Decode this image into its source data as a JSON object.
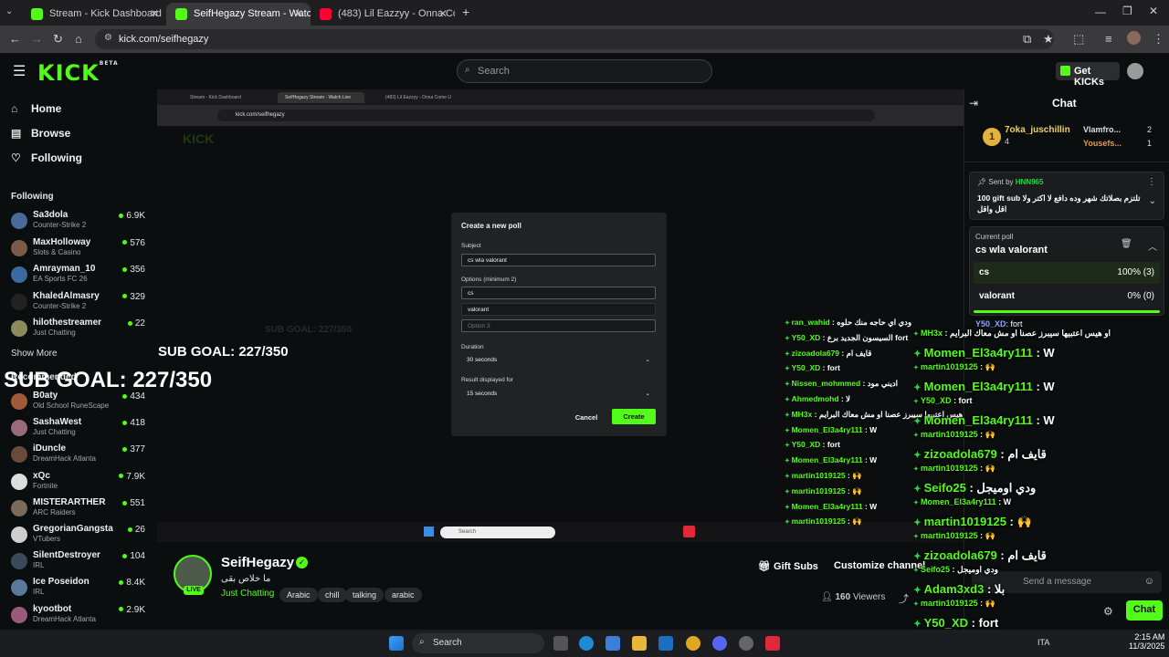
{
  "browser": {
    "tabs": [
      {
        "title": "Stream - Kick Dashboard",
        "favicon_color": "#53fc18"
      },
      {
        "title": "SeifHegazy Stream - Watch Live",
        "favicon_color": "#53fc18"
      },
      {
        "title": "(483) Lil Eazzyy - Onna Come U",
        "favicon_color": "#ff0033"
      }
    ],
    "url": "kick.com/seifhegazy"
  },
  "header": {
    "logo": "KICK",
    "logo_badge": "BETA",
    "search_placeholder": "Search",
    "get_kicks": "Get KICKs"
  },
  "sidebar": {
    "nav": [
      {
        "label": "Home",
        "icon": "home-icon"
      },
      {
        "label": "Browse",
        "icon": "browse-icon"
      },
      {
        "label": "Following",
        "icon": "heart-icon"
      }
    ],
    "following_heading": "Following",
    "following": [
      {
        "name": "Sa3dola",
        "category": "Counter-Strike 2",
        "viewers": "6.9K",
        "avatar_color": "#4a6a9a"
      },
      {
        "name": "MaxHolloway",
        "category": "Slots & Casino",
        "viewers": "576",
        "avatar_color": "#7a5a4a"
      },
      {
        "name": "Amrayman_10",
        "category": "EA Sports FC 26",
        "viewers": "356",
        "avatar_color": "#3a6aa0"
      },
      {
        "name": "KhaledAlmasry",
        "category": "Counter-Strike 2",
        "viewers": "329",
        "avatar_color": "#222222"
      },
      {
        "name": "hilothestreamer",
        "category": "Just Chatting",
        "viewers": "22",
        "avatar_color": "#8a8a5a"
      }
    ],
    "show_more": "Show More",
    "recommended_heading": "Recommended",
    "recommended": [
      {
        "name": "B0aty",
        "category": "Old School RuneScape",
        "viewers": "434",
        "avatar_color": "#a05a3a"
      },
      {
        "name": "SashaWest",
        "category": "Just Chatting",
        "viewers": "418",
        "avatar_color": "#9a6a7a"
      },
      {
        "name": "iDuncle",
        "category": "DreamHack Atlanta",
        "viewers": "377",
        "avatar_color": "#6a4a3a"
      },
      {
        "name": "xQc",
        "category": "Fortnite",
        "viewers": "7.9K",
        "avatar_color": "#dddddd"
      },
      {
        "name": "MISTERARTHER",
        "category": "ARC Raiders",
        "viewers": "551",
        "avatar_color": "#7a6a5a"
      },
      {
        "name": "GregorianGangsta",
        "category": "VTubers",
        "viewers": "26",
        "avatar_color": "#cfcfcf"
      },
      {
        "name": "SilentDestroyer",
        "category": "IRL",
        "viewers": "104",
        "avatar_color": "#3a4a5a"
      },
      {
        "name": "Ice Poseidon",
        "category": "IRL",
        "viewers": "8.4K",
        "avatar_color": "#5a7a9a"
      },
      {
        "name": "kyootbot",
        "category": "DreamHack Atlanta",
        "viewers": "2.9K",
        "avatar_color": "#9a5a7a"
      }
    ]
  },
  "stream_overlay": {
    "sub_goal_small": "SUB GOAL: 227/350",
    "sub_goal_large": "SUB GOAL: 227/350",
    "inner_url": "kick.com/seifhegazy",
    "inner_tabs": [
      "Stream - Kick Dashboard",
      "SeifHegazy Stream - Watch Live",
      "(483) Lil Eazzyy - Onna Come U"
    ],
    "inner_search": "Search",
    "poll_dialog": {
      "title": "Create a new poll",
      "subject_label": "Subject",
      "subject_value": "cs wla valorant",
      "options_label": "Options (minimum 2)",
      "options": [
        "cs",
        "valorant"
      ],
      "option3_placeholder": "Option 3",
      "duration_label": "Duration",
      "duration_value": "30 seconds",
      "result_label": "Result displayed for",
      "result_value": "15 seconds",
      "cancel": "Cancel",
      "create": "Create"
    },
    "small_chat": [
      {
        "user": "ran_wahid",
        "msg": "ودي اي حاجه منك حلوه"
      },
      {
        "user": "Y50_XD",
        "msg": "السيسون الجديد برع fort"
      },
      {
        "user": "zizoadola679",
        "msg": "قايف ام"
      },
      {
        "user": "Y50_XD",
        "msg": "fort"
      },
      {
        "user": "Nissen_mohmmed",
        "msg": "اديني مود"
      },
      {
        "user": "Ahmedmohd",
        "msg": "لا"
      },
      {
        "user": "MH3x",
        "msg": "او هيس اعتبيها سيبرز عصنا او مش معاك البرايم"
      },
      {
        "user": "Momen_El3a4ry111",
        "msg": "W"
      },
      {
        "user": "Y50_XD",
        "msg": "fort"
      },
      {
        "user": "Momen_El3a4ry111",
        "msg": "W"
      },
      {
        "user": "martin1019125",
        "msg": "🙌"
      },
      {
        "user": "martin1019125",
        "msg": "🙌"
      },
      {
        "user": "Momen_El3a4ry111",
        "msg": "W"
      },
      {
        "user": "martin1019125",
        "msg": "🙌"
      }
    ],
    "big_chat": [
      {
        "user": "MH3x",
        "msg": "او هيس اعتبيها سيبرز عصنا او مش معاك البرايم"
      },
      {
        "user": "Momen_El3a4ry111",
        "msg": "W"
      },
      {
        "user": "martin1019125",
        "msg": "🙌"
      },
      {
        "user": "Momen_El3a4ry111",
        "msg": "W"
      },
      {
        "user": "Y50_XD",
        "msg": "fort"
      },
      {
        "user": "Momen_El3a4ry111",
        "msg": "W"
      },
      {
        "user": "martin1019125",
        "msg": "🙌"
      },
      {
        "user": "zizoadola679",
        "msg": "قايف ام"
      },
      {
        "user": "martin1019125",
        "msg": "🙌"
      },
      {
        "user": "Seifo25",
        "msg": "ودي اوميجل"
      },
      {
        "user": "Momen_El3a4ry111",
        "msg": "W"
      },
      {
        "user": "martin1019125",
        "msg": "🙌"
      },
      {
        "user": "martin1019125",
        "msg": "🙌"
      },
      {
        "user": "zizoadola679",
        "msg": "قايف ام"
      },
      {
        "user": "Seifo25",
        "msg": "ودي اوميجل"
      },
      {
        "user": "Adam3xd3",
        "msg": "بلا"
      },
      {
        "user": "martin1019125",
        "msg": "🙌"
      },
      {
        "user": "Y50_XD",
        "msg": "fort"
      }
    ]
  },
  "channel": {
    "name": "SeifHegazy",
    "live_badge": "LIVE",
    "title": "ما خلاص بقى",
    "category": "Just Chatting",
    "tags": [
      "Arabic",
      "chill",
      "talking",
      "arabic"
    ],
    "gift_subs": "Gift Subs",
    "customize": "Customize channel",
    "viewers": "160",
    "viewers_label": "Viewers"
  },
  "chat": {
    "title": "Chat",
    "leaderboard": [
      {
        "rank": "1",
        "name": "7oka_juschillin",
        "count": "4"
      },
      {
        "name": "Vlamfro...",
        "count": "2"
      },
      {
        "name": "Yousefs...",
        "count": "1"
      }
    ],
    "pinned": {
      "sent_by_label": "Sent by",
      "sender": "HNN965",
      "message": "100 gift sub تلتزم بصلاتك شهر وده دافع لا اكتر ولا اقل واقل"
    },
    "poll": {
      "label": "Current poll",
      "question": "cs wla valorant",
      "options": [
        {
          "label": "cs",
          "result": "100% (3)",
          "percent": 100
        },
        {
          "label": "valorant",
          "result": "0% (0)",
          "percent": 0
        }
      ]
    },
    "first_msg": {
      "user": "Y50_XD",
      "msg": "fort"
    },
    "input_placeholder": "Send a message",
    "send_button": "Chat"
  },
  "taskbar": {
    "search": "Search",
    "lang": "ITA",
    "time": "2:15 AM",
    "date": "11/3/2025"
  }
}
